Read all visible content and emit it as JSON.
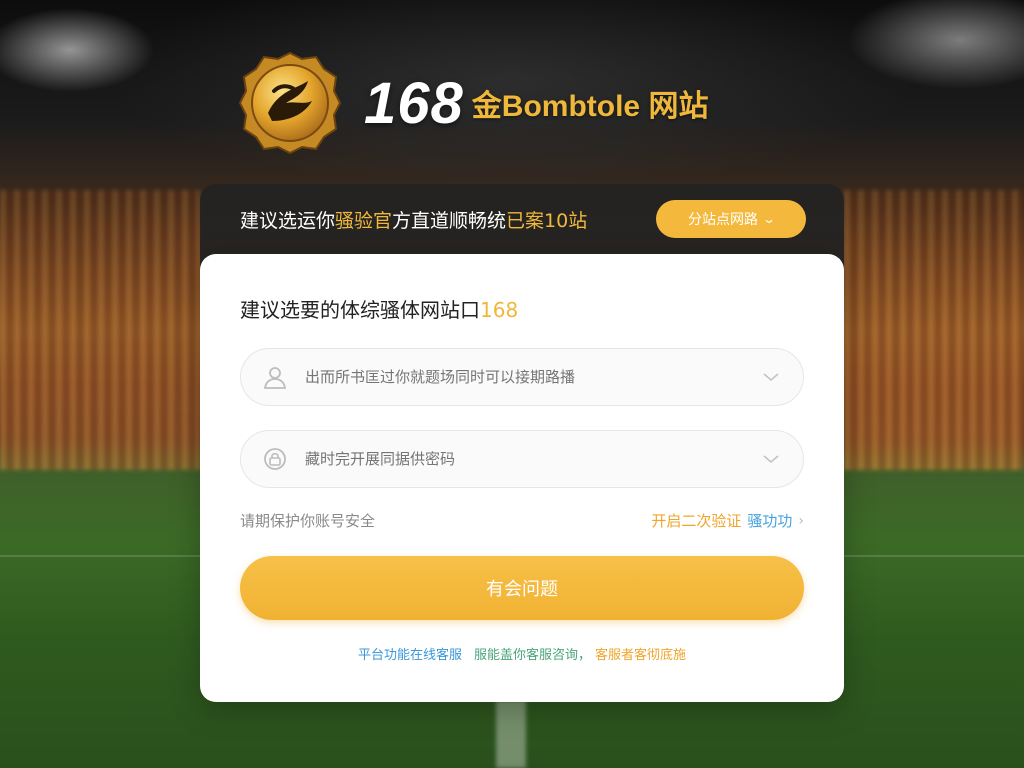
{
  "brand": {
    "number": "168",
    "name": "金Bombtole 网站",
    "logo_icon": "gold-coin-dragon-emblem"
  },
  "banner": {
    "text_prefix": "建议选运你",
    "text_highlight": "骚验官",
    "text_suffix": "方直道顺畅统",
    "text_tail": "已案10站",
    "button_label": "分站点网路",
    "button_icon": "chevron-down-icon"
  },
  "card": {
    "title_text": "建议选要的体综骚体网站口",
    "title_number": "168"
  },
  "username_field": {
    "placeholder": "出而所书匡过你就题场同时可以接期路播",
    "icon": "user-icon",
    "chevron": "chevron-down-icon"
  },
  "password_field": {
    "placeholder": "藏时完开展同据供密码",
    "icon": "lock-icon",
    "chevron": "chevron-down-icon"
  },
  "links": {
    "security_text": "请期保护你账号安全",
    "two_factor_prefix": "开启二次验证",
    "two_factor_suffix": "骚功功",
    "arrow": "›"
  },
  "submit_label": "有会问题",
  "footer": {
    "part1": "平台功能在线客服",
    "part2": "服能盖你客服咨询，",
    "part3": "客服者客彻底施"
  },
  "colors": {
    "accent": "#f4b93c",
    "banner_bg": "#232323",
    "link_blue": "#3a97d8",
    "link_green": "#4aa37a"
  }
}
